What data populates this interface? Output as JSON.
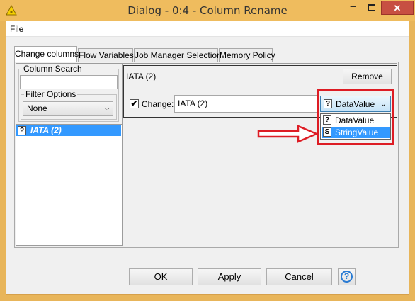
{
  "window": {
    "title": "Dialog - 0:4 - Column Rename",
    "minimize": "–",
    "close": "✕"
  },
  "menu": {
    "file": "File"
  },
  "tabs": [
    {
      "label": "Change columns",
      "active": true
    },
    {
      "label": "Flow Variables",
      "active": false
    },
    {
      "label": "Job Manager Selection",
      "active": false
    },
    {
      "label": "Memory Policy",
      "active": false
    }
  ],
  "left": {
    "column_search_label": "Column Search",
    "search_value": "",
    "filter_options_label": "Filter Options",
    "filter_value": "None",
    "columns": [
      {
        "type_icon": "?",
        "name": "IATA (2)",
        "selected": true
      }
    ]
  },
  "entry": {
    "title": "IATA (2)",
    "remove_label": "Remove",
    "change_checked": true,
    "check_mark": "✔",
    "change_label": "Change:",
    "new_name": "IATA (2)",
    "type_selected_icon": "?",
    "type_selected": "DataValue",
    "type_options": [
      {
        "icon": "?",
        "label": "DataValue",
        "highlighted": false
      },
      {
        "icon": "S",
        "label": "StringValue",
        "highlighted": true
      }
    ]
  },
  "annotation": {
    "color": "#dd1c24"
  },
  "buttons": {
    "ok": "OK",
    "apply": "Apply",
    "cancel": "Cancel",
    "help": "?"
  },
  "icons": {
    "app": "knime-triangle-icon",
    "help": "help-circle-icon",
    "chevron": "chevron-down-icon"
  }
}
